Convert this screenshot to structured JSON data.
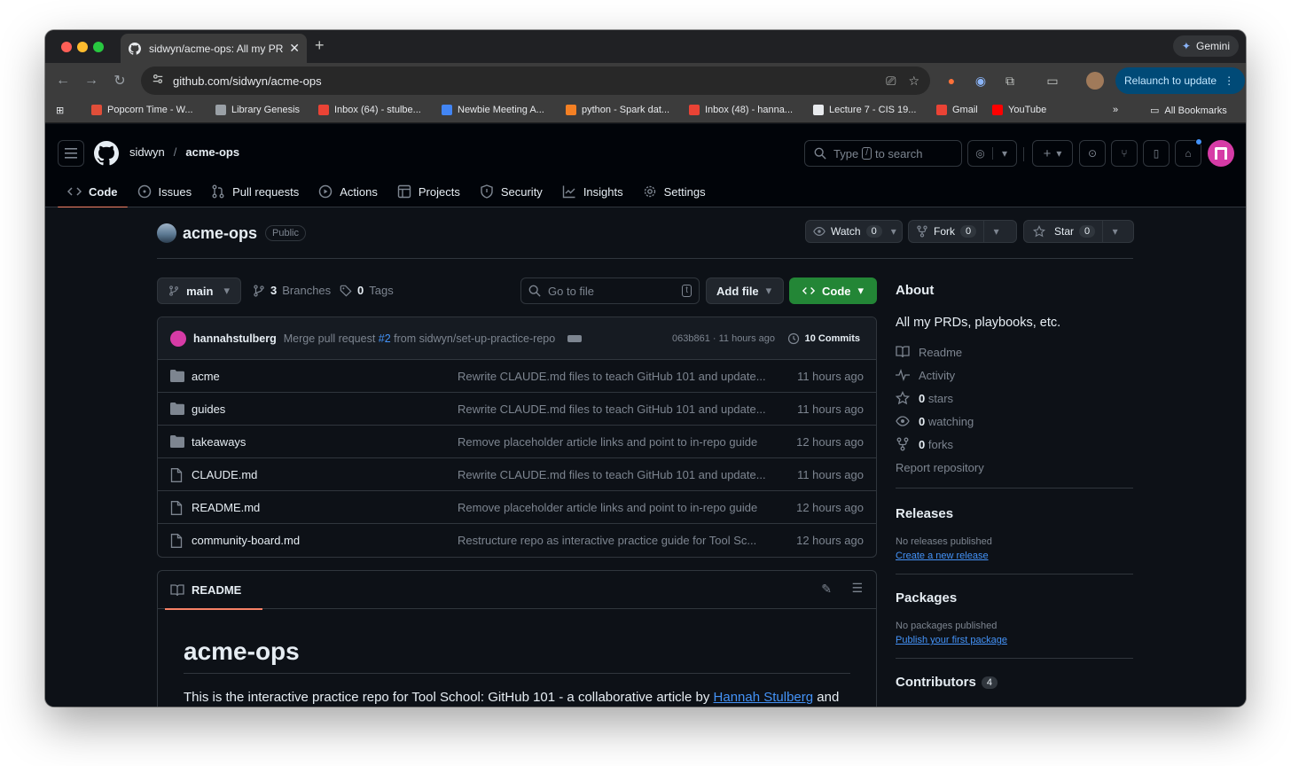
{
  "browser": {
    "tab_title": "sidwyn/acme-ops: All my PRD",
    "gemini_label": "Gemini",
    "url": "github.com/sidwyn/acme-ops",
    "relaunch_label": "Relaunch to update",
    "bookmarks": [
      {
        "label": "Popcorn Time - W...",
        "color": "#e04e39"
      },
      {
        "label": "Library Genesis",
        "color": "#9aa0a6"
      },
      {
        "label": "Inbox (64) - stulbe...",
        "color": "#ea4335"
      },
      {
        "label": "Newbie Meeting A...",
        "color": "#4285f4"
      },
      {
        "label": "python - Spark dat...",
        "color": "#f48024"
      },
      {
        "label": "Inbox (48) - hanna...",
        "color": "#ea4335"
      },
      {
        "label": "Lecture 7 - CIS 19...",
        "color": "#e8eaed"
      },
      {
        "label": "Gmail",
        "color": "#ea4335"
      },
      {
        "label": "YouTube",
        "color": "#ff0000"
      }
    ],
    "all_bookmarks": "All Bookmarks"
  },
  "header": {
    "owner": "sidwyn",
    "separator": "/",
    "repo": "acme-ops",
    "search_prefix": "Type",
    "search_key": "/",
    "search_suffix": "to search"
  },
  "nav": {
    "code": "Code",
    "issues": "Issues",
    "pulls": "Pull requests",
    "actions": "Actions",
    "projects": "Projects",
    "security": "Security",
    "insights": "Insights",
    "settings": "Settings"
  },
  "repo": {
    "name": "acme-ops",
    "visibility": "Public",
    "watch_label": "Watch",
    "watch_count": "0",
    "fork_label": "Fork",
    "fork_count": "0",
    "star_label": "Star",
    "star_count": "0"
  },
  "branchbar": {
    "branch": "main",
    "branches_count": "3",
    "branches_label": "Branches",
    "tags_count": "0",
    "tags_label": "Tags",
    "goto_placeholder": "Go to file",
    "goto_key": "t",
    "add_file": "Add file",
    "code_button": "Code"
  },
  "commit": {
    "author": "hannahstulberg",
    "msg_prefix": "Merge pull request",
    "pr": "#2",
    "msg_suffix": "from sidwyn/set-up-practice-repo",
    "sha": "063b861 · 11 hours ago",
    "commits": "10 Commits"
  },
  "files": [
    {
      "name": "acme",
      "type": "dir",
      "message": "Rewrite CLAUDE.md files to teach GitHub 101 and update...",
      "time": "11 hours ago"
    },
    {
      "name": "guides",
      "type": "dir",
      "message": "Rewrite CLAUDE.md files to teach GitHub 101 and update...",
      "time": "11 hours ago"
    },
    {
      "name": "takeaways",
      "type": "dir",
      "message": "Remove placeholder article links and point to in-repo guide",
      "time": "12 hours ago"
    },
    {
      "name": "CLAUDE.md",
      "type": "file",
      "message": "Rewrite CLAUDE.md files to teach GitHub 101 and update...",
      "time": "11 hours ago"
    },
    {
      "name": "README.md",
      "type": "file",
      "message": "Remove placeholder article links and point to in-repo guide",
      "time": "12 hours ago"
    },
    {
      "name": "community-board.md",
      "type": "file",
      "message": "Restructure repo as interactive practice guide for Tool Sc...",
      "time": "12 hours ago"
    }
  ],
  "readme": {
    "tab": "README",
    "title": "acme-ops",
    "para_prefix": "This is the interactive practice repo for Tool School: GitHub 101 - a collaborative article by",
    "para_link": "Hannah Stulberg",
    "para_suffix": "and"
  },
  "about": {
    "title": "About",
    "description": "All my PRDs, playbooks, etc.",
    "readme": "Readme",
    "activity": "Activity",
    "stars_count": "0",
    "stars_label": "stars",
    "watching_count": "0",
    "watching_label": "watching",
    "forks_count": "0",
    "forks_label": "forks",
    "report": "Report repository"
  },
  "releases": {
    "title": "Releases",
    "none": "No releases published",
    "create": "Create a new release"
  },
  "packages": {
    "title": "Packages",
    "none": "No packages published",
    "publish": "Publish your first package"
  },
  "contributors": {
    "title": "Contributors",
    "count": "4"
  }
}
